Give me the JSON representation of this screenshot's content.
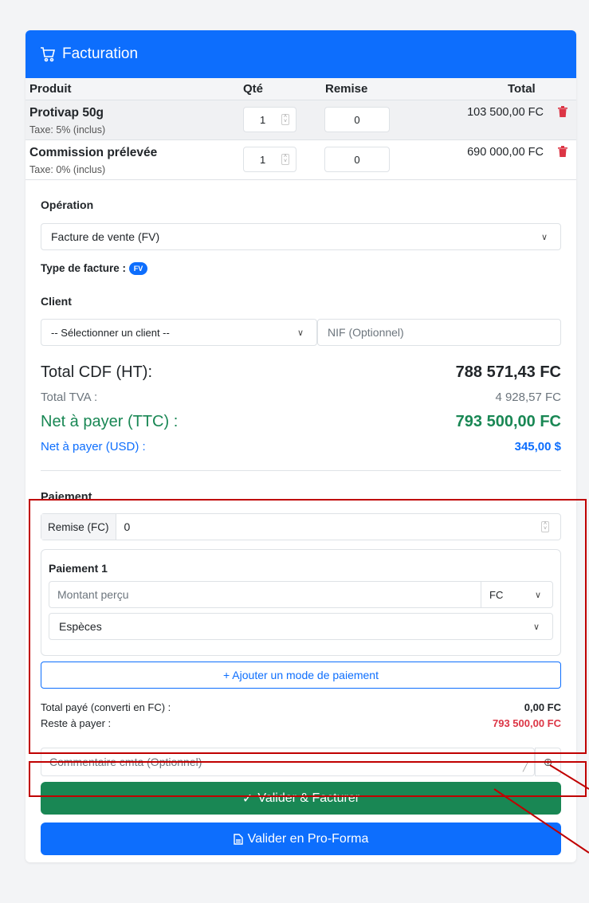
{
  "header": {
    "title": "Facturation",
    "icon": "cart-icon"
  },
  "table": {
    "headers": {
      "product": "Produit",
      "qty": "Qté",
      "discount": "Remise",
      "total": "Total"
    },
    "rows": [
      {
        "name": "Protivap 50g",
        "tax": "Taxe: 5% (inclus)",
        "qty": "1",
        "discount": "0",
        "total": "103 500,00 FC"
      },
      {
        "name": "Commission prélevée",
        "tax": "Taxe: 0% (inclus)",
        "qty": "1",
        "discount": "0",
        "total": "690 000,00 FC"
      }
    ]
  },
  "operation": {
    "label": "Opération",
    "value": "Facture de vente (FV)"
  },
  "invoice_type": {
    "label": "Type de facture :",
    "badge": "FV"
  },
  "client": {
    "label": "Client",
    "select_value": "-- Sélectionner un client --",
    "nif_placeholder": "NIF (Optionnel)"
  },
  "totals": {
    "ht_label": "Total CDF (HT):",
    "ht_value": "788 571,43 FC",
    "tva_label": "Total TVA :",
    "tva_value": "4 928,57 FC",
    "ttc_label": "Net à payer (TTC) :",
    "ttc_value": "793 500,00 FC",
    "usd_label": "Net à payer (USD) :",
    "usd_value": "345,00 $"
  },
  "payment": {
    "title": "Paiement",
    "discount_label": "Remise (FC)",
    "discount_value": "0",
    "entry_title": "Paiement 1",
    "amount_placeholder": "Montant perçu",
    "currency": "FC",
    "method": "Espèces",
    "add_button": "+ Ajouter un mode de paiement",
    "paid_label": "Total payé (converti en FC) :",
    "paid_value": "0,00 FC",
    "remaining_label": "Reste à payer :",
    "remaining_value": "793 500,00 FC"
  },
  "comment": {
    "placeholder": "Commentaire cmta (Optionnel)"
  },
  "actions": {
    "validate": "Valider & Facturer",
    "proforma": "Valider en Pro-Forma"
  },
  "colors": {
    "primary": "#0d6efd",
    "success": "#198754",
    "danger": "#dc3545",
    "annotation": "#c00000"
  }
}
